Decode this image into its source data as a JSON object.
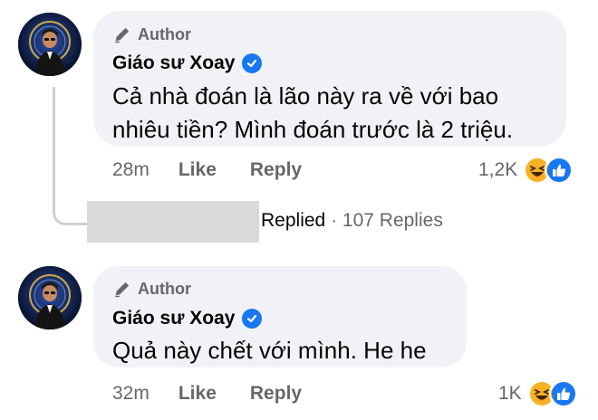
{
  "comments": [
    {
      "badge": "Author",
      "name": "Giáo sư Xoay",
      "text_line1": "Cả nhà đoán là lão này ra về với bao",
      "text_line2": "nhiêu tiền? Mình đoán trước là 2 triệu.",
      "time": "28m",
      "like_label": "Like",
      "reply_label": "Reply",
      "reaction_count": "1,2K",
      "reaction_icons": [
        "haha-icon",
        "like-icon"
      ]
    },
    {
      "badge": "Author",
      "name": "Giáo sư Xoay",
      "text_line1": "Quả này chết với mình. He he",
      "time": "32m",
      "like_label": "Like",
      "reply_label": "Reply",
      "reaction_count": "1K",
      "reaction_icons": [
        "haha-icon",
        "like-icon"
      ]
    }
  ],
  "replies": {
    "status": "Replied",
    "separator": "·",
    "count_label": "107 Replies"
  },
  "colors": {
    "bubble": "#f0f2f5",
    "secondary_text": "#65676b",
    "verified_blue": "#1877f2",
    "like_blue": "#1877f2",
    "haha_yellow": "#f7b125"
  }
}
